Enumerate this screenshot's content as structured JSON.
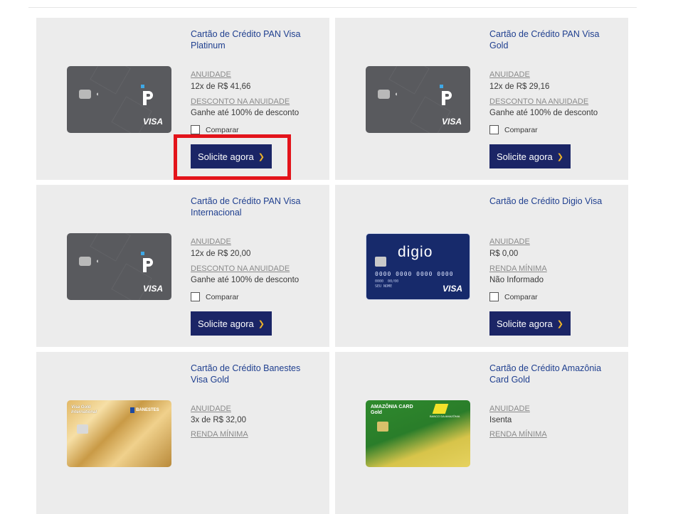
{
  "common": {
    "annuity_label": "ANUIDADE",
    "discount_label": "DESCONTO NA ANUIDADE",
    "min_income_label": "RENDA MÍNIMA",
    "compare_label": "Comparar",
    "apply_label": "Solicite agora",
    "apply_chevron": "❯"
  },
  "cards": [
    {
      "title": "Cartão de Crédito PAN Visa Platinum",
      "annuity": "12x de R$ 41,66",
      "second_label": "DESCONTO NA ANUIDADE",
      "second_value": "Ganhe até 100% de desconto",
      "image": "pan-visa-card",
      "highlighted": true
    },
    {
      "title": "Cartão de Crédito PAN Visa Gold",
      "annuity": "12x de R$ 29,16",
      "second_label": "DESCONTO NA ANUIDADE",
      "second_value": "Ganhe até 100% de desconto",
      "image": "pan-visa-card"
    },
    {
      "title": "Cartão de Crédito PAN Visa Internacional",
      "annuity": "12x de R$ 20,00",
      "second_label": "DESCONTO NA ANUIDADE",
      "second_value": "Ganhe até 100% de desconto",
      "image": "pan-visa-card"
    },
    {
      "title": "Cartão de Crédito Digio Visa",
      "annuity": "R$ 0,00",
      "second_label": "RENDA MÍNIMA",
      "second_value": "Não Informado",
      "image": "digio-visa-card",
      "card_brand": "digio",
      "card_number": "0000  0000  0000  0000",
      "card_small_text": "0000  00/00\nSEU NOME"
    },
    {
      "title": "Cartão de Crédito Banestes Visa Gold",
      "annuity": "3x de R$ 32,00",
      "second_label": "RENDA MÍNIMA",
      "second_value": "",
      "image": "banestes-visa-gold-card",
      "card_text": "Visa Gold\nInternational",
      "card_bank": "BANESTES"
    },
    {
      "title": "Cartão de Crédito Amazônia Card Gold",
      "annuity": "Isenta",
      "second_label": "RENDA MÍNIMA",
      "second_value": "",
      "image": "amazonia-card-gold",
      "card_brand": "AMAZÔNIA CARD\nGold",
      "card_bank": "BANCO DA AMAZÔNIA"
    }
  ],
  "visa_text": "VISA",
  "colors": {
    "panel_bg": "#ececec",
    "title": "#1f3f8f",
    "button_bg": "#1b2566",
    "chevron": "#f0b429",
    "highlight": "#e3141b"
  }
}
